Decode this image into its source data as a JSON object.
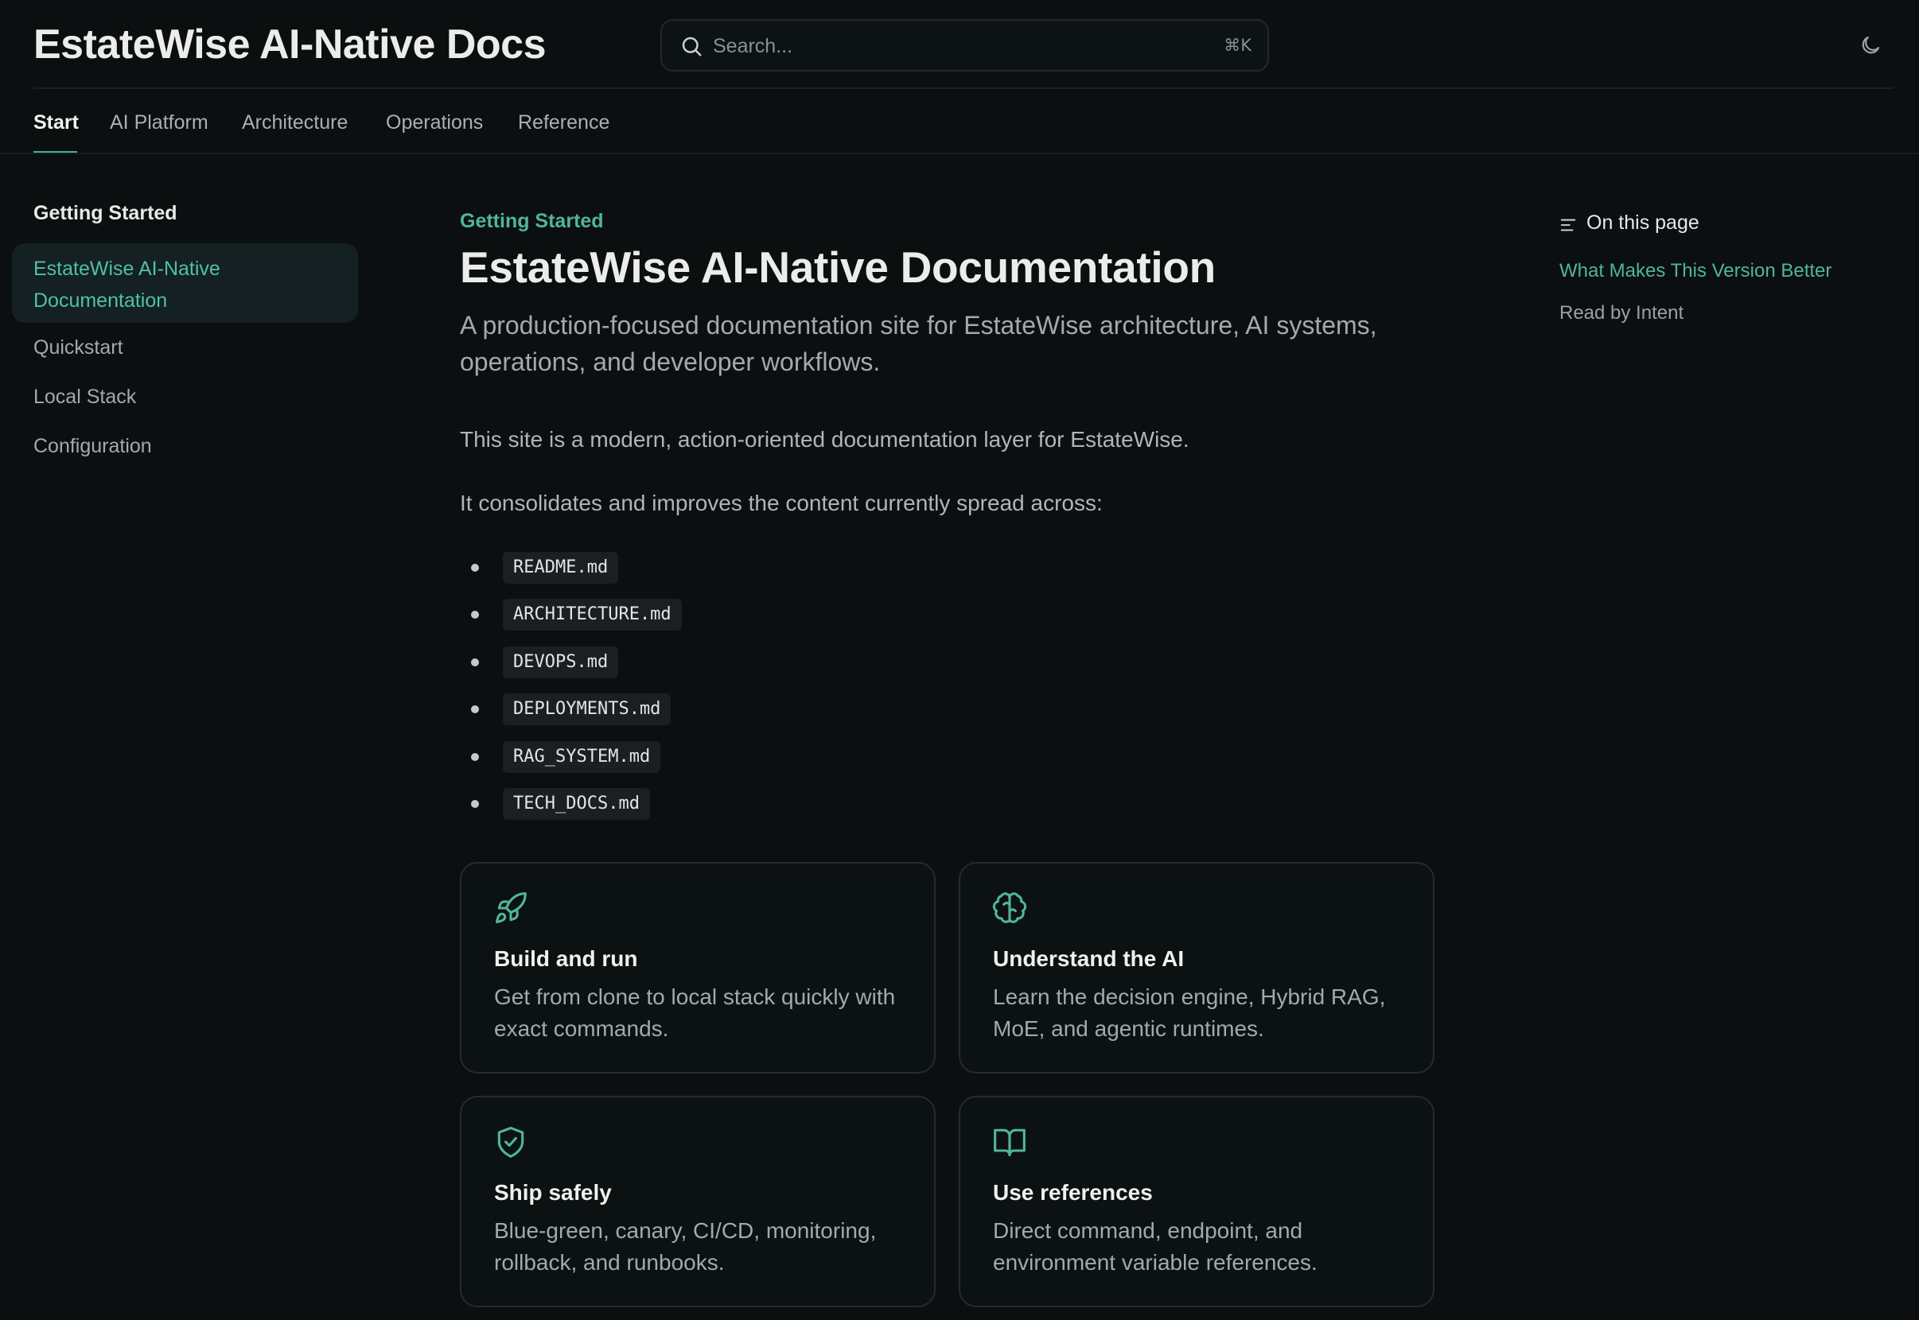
{
  "header": {
    "site_title": "EstateWise AI-Native Docs",
    "search_placeholder": "Search...",
    "search_shortcut": "⌘K",
    "theme_toggle_icon": "moon-icon"
  },
  "tabs": [
    {
      "label": "Start",
      "active": true
    },
    {
      "label": "AI Platform",
      "active": false
    },
    {
      "label": "Architecture",
      "active": false
    },
    {
      "label": "Operations",
      "active": false
    },
    {
      "label": "Reference",
      "active": false
    }
  ],
  "sidebar": {
    "heading": "Getting Started",
    "active_item": "EstateWise AI-Native Documentation",
    "items": [
      "Quickstart",
      "Local Stack",
      "Configuration"
    ]
  },
  "main": {
    "eyebrow": "Getting Started",
    "title": "EstateWise AI-Native Documentation",
    "lead": "A production-focused documentation site for EstateWise architecture, AI systems, operations, and developer workflows.",
    "para1": "This site is a modern, action-oriented documentation layer for EstateWise.",
    "para2": "It consolidates and improves the content currently spread across:",
    "files": [
      "README.md",
      "ARCHITECTURE.md",
      "DEVOPS.md",
      "DEPLOYMENTS.md",
      "RAG_SYSTEM.md",
      "TECH_DOCS.md"
    ],
    "cards": [
      {
        "icon": "rocket-icon",
        "title": "Build and run",
        "desc": "Get from clone to local stack quickly with exact commands."
      },
      {
        "icon": "brain-icon",
        "title": "Understand the AI",
        "desc": "Learn the decision engine, Hybrid RAG, MoE, and agentic runtimes."
      },
      {
        "icon": "shield-check-icon",
        "title": "Ship safely",
        "desc": "Blue-green, canary, CI/CD, monitoring, rollback, and runbooks."
      },
      {
        "icon": "book-open-icon",
        "title": "Use references",
        "desc": "Direct command, endpoint, and environment variable references."
      }
    ]
  },
  "toc": {
    "heading": "On this page",
    "links": [
      {
        "label": "What Makes This Version Better",
        "active": true
      },
      {
        "label": "Read by Intent",
        "active": false
      }
    ]
  },
  "colors": {
    "background": "#0b0f10",
    "accent": "#4fb59c",
    "text_primary": "#ececec",
    "text_muted": "#a3aaac",
    "border": "#252b2d"
  }
}
